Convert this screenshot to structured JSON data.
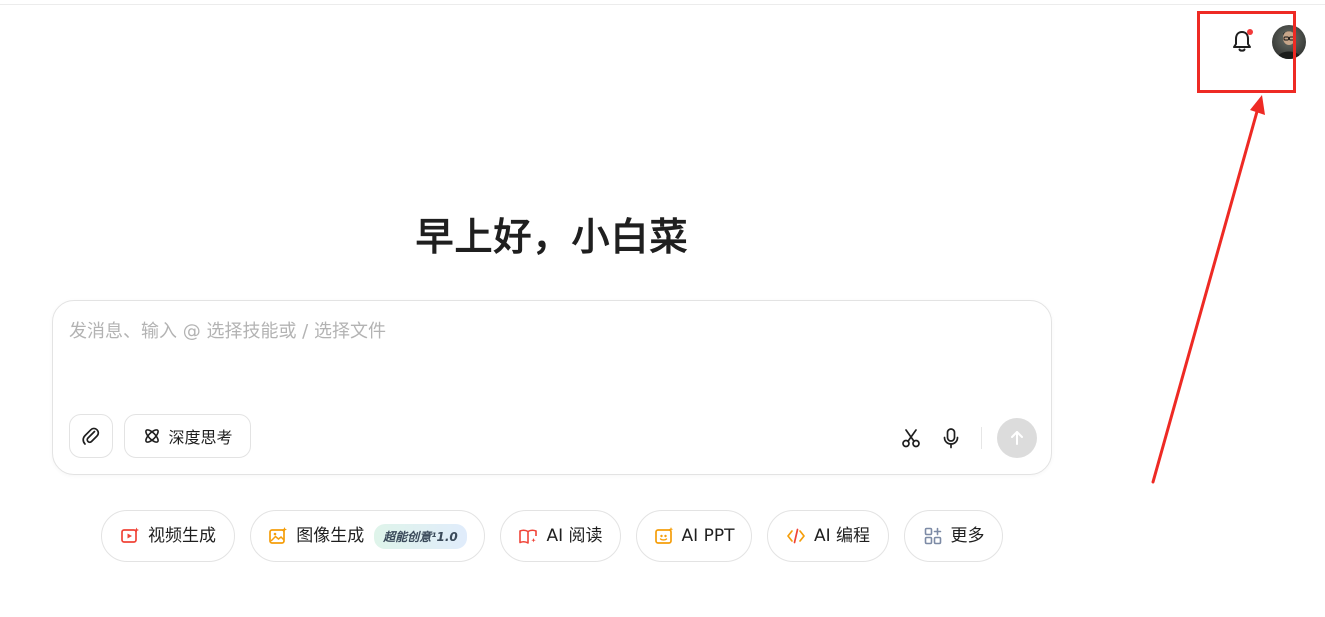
{
  "greeting": "早上好，小白菜",
  "composer": {
    "placeholder": "发消息、输入 @ 选择技能或 / 选择文件",
    "deep_think_label": "深度思考"
  },
  "chips": [
    {
      "label": "视频生成",
      "icon": "video-gen-icon",
      "color": "#f04438"
    },
    {
      "label": "图像生成",
      "icon": "image-gen-icon",
      "color": "#f59e0b",
      "badge": "超能创意¹1.0"
    },
    {
      "label": "AI 阅读",
      "icon": "book-icon",
      "color": "#f04438"
    },
    {
      "label": "AI PPT",
      "icon": "ppt-icon",
      "color": "#f59e0b"
    },
    {
      "label": "AI 编程",
      "icon": "code-icon",
      "color": "#f59e0b"
    },
    {
      "label": "更多",
      "icon": "grid-more-icon",
      "color": "#7c8aa5"
    }
  ],
  "colors": {
    "accent_red": "#ee2a24",
    "notification_dot": "#f23a3a",
    "send_disabled": "#dcdcdc"
  }
}
